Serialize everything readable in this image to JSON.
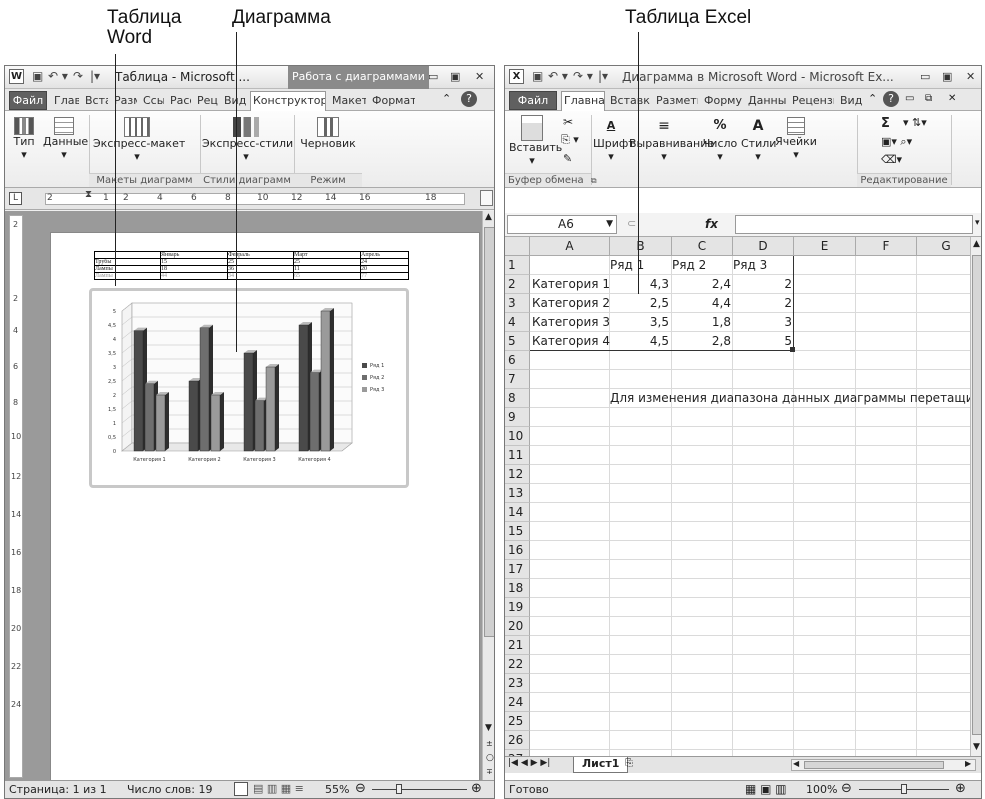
{
  "labels": {
    "word_table": "Таблица\nWord",
    "diagram": "Диаграмма",
    "excel_table": "Таблица Excel"
  },
  "word": {
    "title": "Таблица - Microsoft ...",
    "context_tab": "Работа с диаграммами",
    "tabs": [
      "Файл",
      "Глав",
      "Вста",
      "Разм",
      "Ссы",
      "Расс",
      "Рец",
      "Вид",
      "Конструктор",
      "Макет",
      "Формат"
    ],
    "ribbon": {
      "type": "Тип",
      "data": "Данные",
      "express_layout": "Экспресс-макет",
      "express_styles": "Экспресс-стили",
      "draft": "Черновик"
    },
    "groups": {
      "layouts": "Макеты диаграмм",
      "styles": "Стили диаграмм",
      "mode": "Режим"
    },
    "ruler": [
      "2",
      "1",
      "2",
      "4",
      "6",
      "8",
      "10",
      "12",
      "14",
      "16",
      "18"
    ],
    "vruler": [
      "2",
      "2",
      "4",
      "6",
      "8",
      "10",
      "12",
      "14",
      "16",
      "18",
      "20",
      "22",
      "24"
    ],
    "doc_table": {
      "headers": [
        "",
        "Январь",
        "Февраль",
        "Март",
        "Апрель"
      ],
      "rows": [
        [
          "Трубы",
          "15",
          "25",
          "25",
          "24"
        ],
        [
          "Лампы",
          "18",
          "36",
          "11",
          "20"
        ],
        [
          "Лампы",
          "44",
          "34",
          "65",
          "77"
        ]
      ]
    },
    "status": {
      "page": "Страница: 1 из 1",
      "words": "Число слов: 19",
      "zoom": "55%"
    }
  },
  "chart_data": {
    "type": "bar",
    "categories": [
      "Категория 1",
      "Категория 2",
      "Категория 3",
      "Категория 4"
    ],
    "series": [
      {
        "name": "Ряд 1",
        "values": [
          4.3,
          2.5,
          3.5,
          4.5
        ]
      },
      {
        "name": "Ряд 2",
        "values": [
          2.4,
          4.4,
          1.8,
          2.8
        ]
      },
      {
        "name": "Ряд 3",
        "values": [
          2,
          2,
          3,
          5
        ]
      }
    ],
    "ylim": [
      0,
      5
    ],
    "yticks": [
      "0",
      "0,5",
      "1",
      "1,5",
      "2",
      "2,5",
      "3",
      "3,5",
      "4",
      "4,5",
      "5"
    ],
    "legend": "right",
    "colors": [
      "#4a4a4a",
      "#6e6e6e",
      "#9a9a9a"
    ]
  },
  "excel": {
    "title": "Диаграмма в Microsoft Word - Microsoft Ex...",
    "tabs": [
      "Файл",
      "Главная",
      "Вставка",
      "Разметк",
      "Формул",
      "Данные",
      "Рецензи",
      "Вид"
    ],
    "ribbon": {
      "paste": "Вставить",
      "font": "Шрифт",
      "align": "Выравнивание",
      "number": "Число",
      "styles": "Стили",
      "cells": "Ячейки",
      "percent": "%",
      "sigma": "Σ"
    },
    "groups": {
      "clipboard": "Буфер обмена",
      "editing": "Редактирование"
    },
    "namebox": "A6",
    "fx": "fx",
    "columns": [
      "A",
      "B",
      "C",
      "D",
      "E",
      "F",
      "G"
    ],
    "row_numbers": [
      "1",
      "2",
      "3",
      "4",
      "5",
      "6",
      "7",
      "8",
      "9",
      "10",
      "11",
      "12",
      "13",
      "14",
      "15",
      "16",
      "17",
      "18",
      "19",
      "20",
      "21",
      "22",
      "23",
      "24",
      "25",
      "26",
      "27"
    ],
    "cells": {
      "b1": "Ряд 1",
      "c1": "Ряд 2",
      "d1": "Ряд 3",
      "a2": "Категория 1",
      "b2": "4,3",
      "c2": "2,4",
      "d2": "2",
      "a3": "Категория 2",
      "b3": "2,5",
      "c3": "4,4",
      "d3": "2",
      "a4": "Категория 3",
      "b4": "3,5",
      "c4": "1,8",
      "d4": "3",
      "a5": "Категория 4",
      "b5": "4,5",
      "c5": "2,8",
      "d5": "5",
      "b8": "Для изменения диапазона данных диаграммы перетащите"
    },
    "sheet_tab": "Лист1",
    "status": {
      "ready": "Готово",
      "zoom": "100%"
    }
  }
}
